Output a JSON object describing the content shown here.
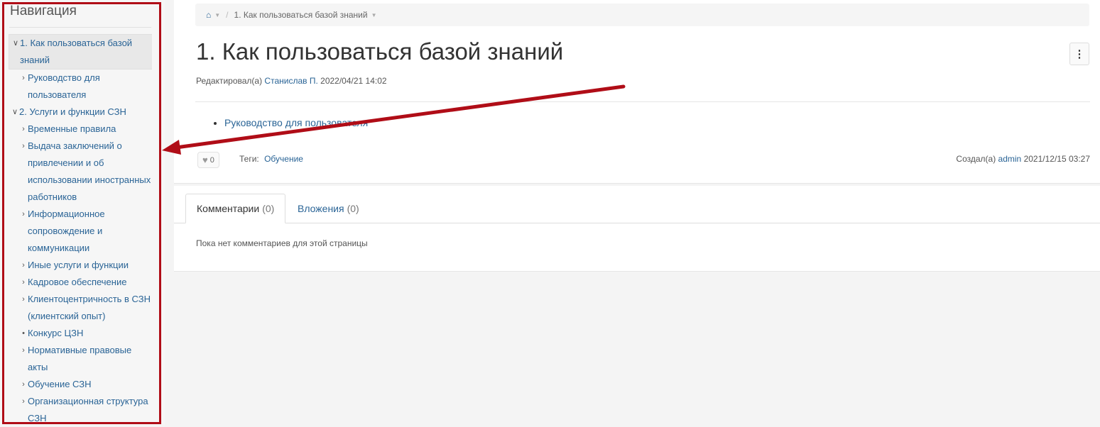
{
  "sidebar": {
    "title": "Навигация",
    "items": [
      {
        "label": "1. Как пользоваться базой знаний",
        "level": 1,
        "icon": "chevron-down-icon",
        "active": true
      },
      {
        "label": "Руководство для пользователя",
        "level": 2,
        "icon": "chevron-right-icon"
      },
      {
        "label": "2. Услуги и функции СЗН",
        "level": 1,
        "icon": "chevron-down-icon"
      },
      {
        "label": "Временные правила",
        "level": 2,
        "icon": "chevron-right-icon"
      },
      {
        "label": "Выдача заключений о привлечении и об использовании иностранных работников",
        "level": 2,
        "icon": "chevron-right-icon"
      },
      {
        "label": "Информационное сопровождение и коммуникации",
        "level": 2,
        "icon": "chevron-right-icon"
      },
      {
        "label": "Иные услуги и функции",
        "level": 2,
        "icon": "chevron-right-icon"
      },
      {
        "label": "Кадровое обеспечение",
        "level": 2,
        "icon": "chevron-right-icon"
      },
      {
        "label": "Клиентоцентричность в СЗН (клиентский опыт)",
        "level": 2,
        "icon": "chevron-right-icon"
      },
      {
        "label": "Конкурс ЦЗН",
        "level": 2,
        "icon": "bullet-icon"
      },
      {
        "label": "Нормативные правовые акты",
        "level": 2,
        "icon": "chevron-right-icon"
      },
      {
        "label": "Обучение СЗН",
        "level": 2,
        "icon": "chevron-right-icon"
      },
      {
        "label": "Организационная структура СЗН",
        "level": 2,
        "icon": "chevron-right-icon"
      }
    ]
  },
  "breadcrumb": {
    "home_icon": "home-icon",
    "current": "1. Как пользоваться базой знаний"
  },
  "page": {
    "title": "1. Как пользоваться базой знаний",
    "edited_prefix": "Редактировал(а)",
    "edited_by": "Станислав П.",
    "edited_at": "2022/04/21 14:02",
    "links": [
      "Руководство для пользователя"
    ],
    "likes": "0",
    "tags_label": "Теги:",
    "tag": "Обучение",
    "created_prefix": "Создал(а)",
    "created_by": "admin",
    "created_at": "2021/12/15 03:27"
  },
  "tabs": {
    "comments_label": "Комментарии",
    "comments_count": "(0)",
    "attachments_label": "Вложения",
    "attachments_count": "(0)",
    "empty_text": "Пока нет комментариев для этой страницы"
  },
  "colors": {
    "annotation_red": "#b00d17",
    "link": "#2a6496"
  }
}
